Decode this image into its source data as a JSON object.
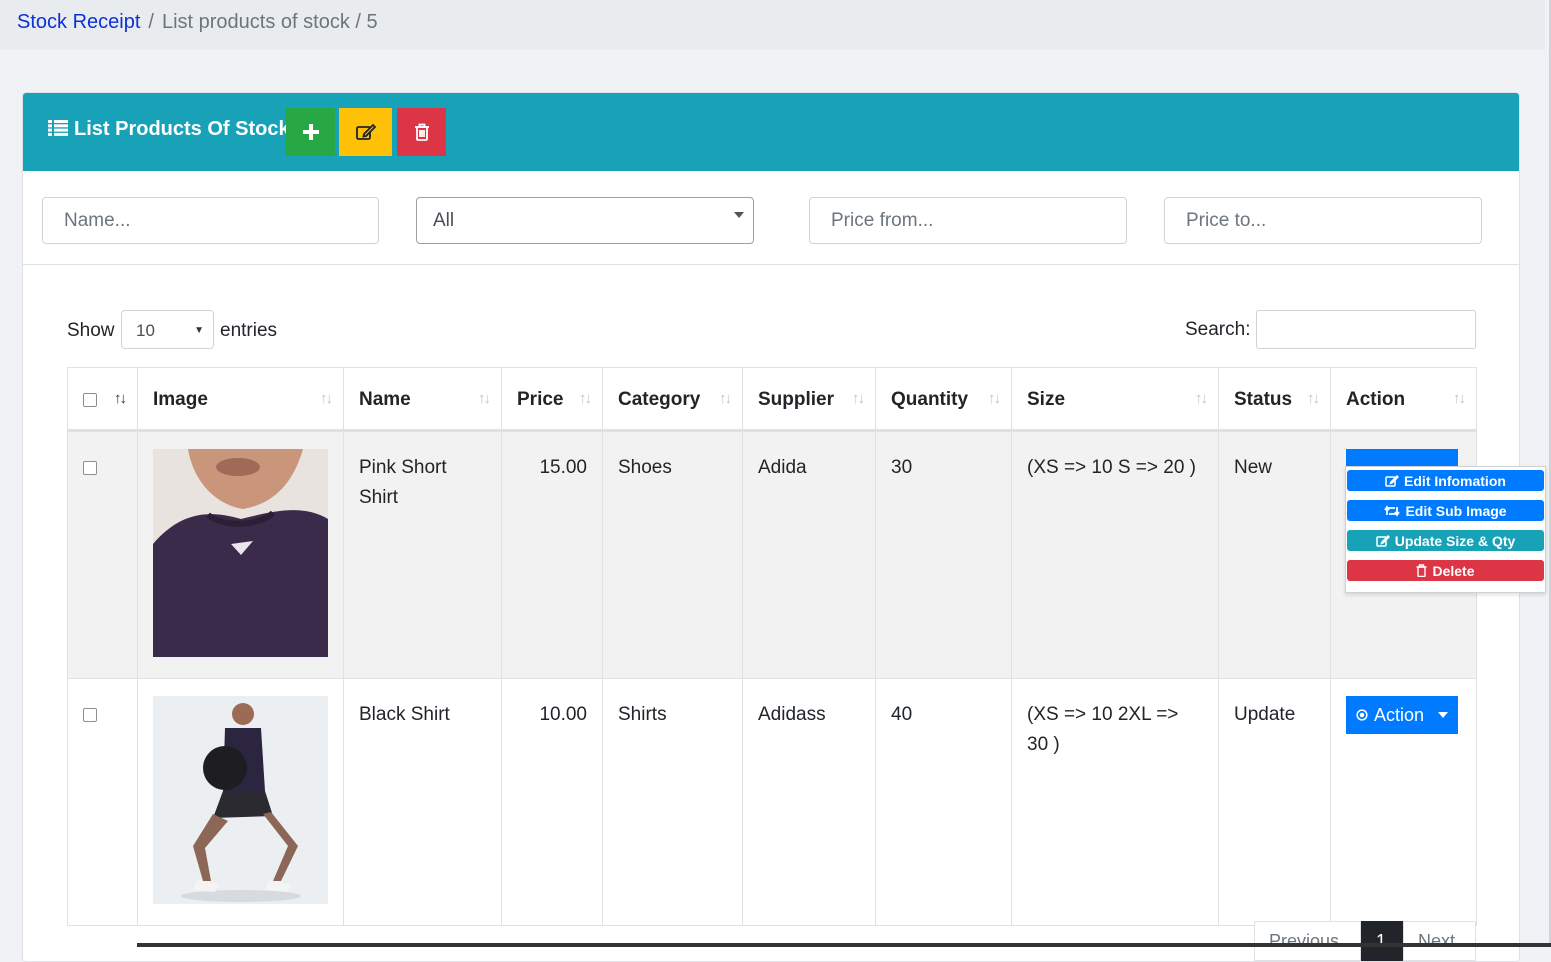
{
  "breadcrumb": {
    "root": "Stock Receipt",
    "separator": "/",
    "current": "List products of stock / 5"
  },
  "header": {
    "title": "List Products Of Stock",
    "title_icon": "list-icon",
    "add_icon": "plus-icon",
    "edit_icon": "edit-icon",
    "delete_icon": "trash-icon"
  },
  "filters": {
    "name_placeholder": "Name...",
    "category_value": "All",
    "price_from_placeholder": "Price from...",
    "price_to_placeholder": "Price to..."
  },
  "datatable": {
    "show_label": "Show",
    "length_value": "10",
    "entries_label": "entries",
    "search_label": "Search:"
  },
  "columns": [
    "Image",
    "Name",
    "Price",
    "Category",
    "Supplier",
    "Quantity",
    "Size",
    "Status",
    "Action"
  ],
  "rows": [
    {
      "name": "Pink Short Shirt",
      "price": "15.00",
      "category": "Shoes",
      "supplier": "Adida",
      "quantity": "30",
      "size": "(XS => 10 S => 20 )",
      "status": "New"
    },
    {
      "name": "Black Shirt",
      "price": "10.00",
      "category": "Shirts",
      "supplier": "Adidass",
      "quantity": "40",
      "size": "(XS => 10 2XL => 30 )",
      "status": "Update",
      "action_label": "Action"
    }
  ],
  "action_menu": {
    "edit_info": "Edit Infomation",
    "edit_sub_image": "Edit Sub Image",
    "update_size_qty": "Update Size & Qty",
    "delete": "Delete"
  },
  "pagination": {
    "previous": "Previous",
    "current": "1",
    "next": "Next"
  },
  "colors": {
    "header": "#17a2b8",
    "primary": "#007bff",
    "success": "#28a745",
    "warning": "#ffc107",
    "danger": "#dc3545",
    "link": "#0d30d6"
  }
}
